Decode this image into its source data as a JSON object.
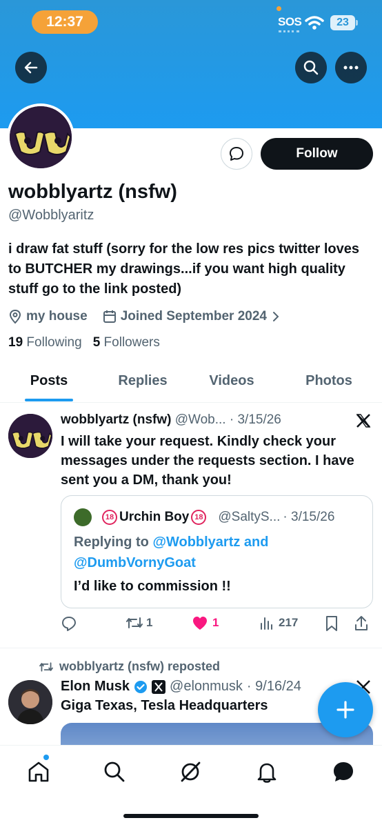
{
  "status_bar": {
    "time": "12:37",
    "carrier": "SOS",
    "battery": "23"
  },
  "profile": {
    "display_name": "wobblyartz (nsfw)",
    "handle": "@Wobblyaritz",
    "bio": "i draw fat stuff (sorry for the low res pics twitter loves to BUTCHER my drawings...if you want high quality stuff go to the link posted)",
    "location": "my house",
    "joined": "Joined September 2024",
    "following_count": "19",
    "following_label": "Following",
    "followers_count": "5",
    "followers_label": "Followers",
    "follow_label": "Follow"
  },
  "tabs": [
    {
      "label": "Posts",
      "active": true
    },
    {
      "label": "Replies",
      "active": false
    },
    {
      "label": "Videos",
      "active": false
    },
    {
      "label": "Photos",
      "active": false
    }
  ],
  "tweet1": {
    "name": "wobblyartz (nsfw)",
    "handle": "@Wob...",
    "date": "· 3/15/26",
    "text": "I will take your request. Kindly check your messages under the requests section. I have sent you a DM, thank you!",
    "quote": {
      "name": "Urchin Boy",
      "badge": "18",
      "handle": "@SaltyS...",
      "date": "· 3/15/26",
      "replying_prefix": "Replying to ",
      "replying_user1": "@Wobblyartz",
      "replying_and": " and",
      "replying_user2": "@DumbVornyGoat",
      "text": "I’d like to commission !!"
    },
    "retweets": "1",
    "likes": "1",
    "views": "217"
  },
  "tweet2": {
    "repost_label": "wobblyartz (nsfw) reposted",
    "name": "Elon Musk",
    "handle": "@elonmusk",
    "date": "· 9/16/24",
    "text": "Giga Texas, Tesla Headquarters"
  },
  "colors": {
    "accent": "#1d9bf0",
    "like": "#f91880",
    "text": "#0f1419",
    "muted": "#536471"
  }
}
